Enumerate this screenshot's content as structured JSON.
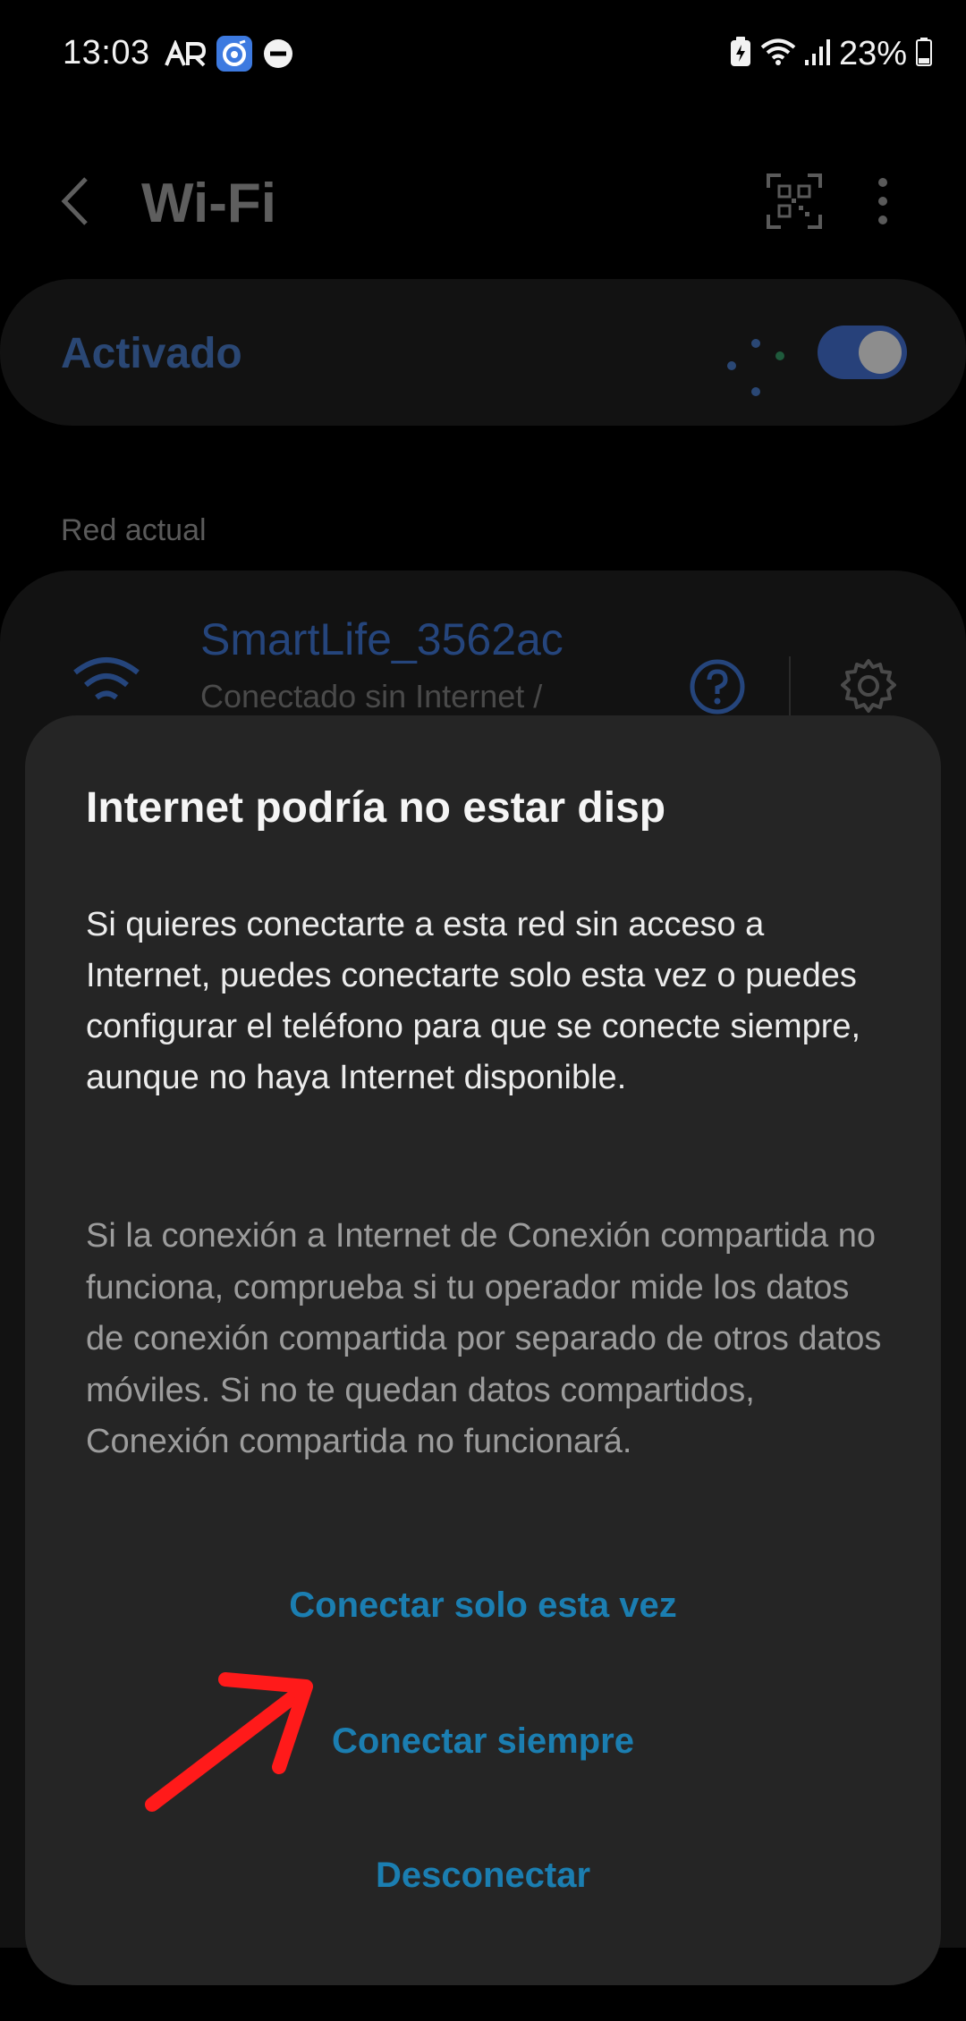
{
  "status_bar": {
    "time": "13:03",
    "battery": "23%",
    "left_icons": [
      "ar-icon",
      "app-notification-icon",
      "dnd-icon"
    ],
    "right_icons": [
      "battery-saver-icon",
      "wifi-signal-icon",
      "cell-signal-icon",
      "battery-icon"
    ]
  },
  "app_bar": {
    "title": "Wi-Fi"
  },
  "wifi_toggle": {
    "label": "Activado",
    "state": "on"
  },
  "current_network": {
    "section_label": "Red actual",
    "name": "SmartLife_3562ac",
    "status": "Conectado sin Internet /"
  },
  "dialog": {
    "title": "Internet podría no estar disp",
    "message": "Si quieres conectarte a esta red sin acceso a Internet, puedes conectarte solo esta vez o puedes configurar el teléfono para que se conecte siempre, aunque no haya Internet disponible.",
    "note": "Si la conexión a Internet de Conexión compartida no funciona, comprueba si tu operador mide los datos de conexión compartida por separado de otros datos móviles. Si no te quedan datos compartidos, Conexión compartida no funcionará.",
    "buttons": {
      "connect_once": "Conectar solo esta vez",
      "connect_always": "Conectar siempre",
      "disconnect": "Desconectar"
    }
  },
  "colors": {
    "background": "#000000",
    "dialog_bg": "#252525",
    "accent_button": "#1b7eb1",
    "annotation_arrow": "#ff0000"
  }
}
